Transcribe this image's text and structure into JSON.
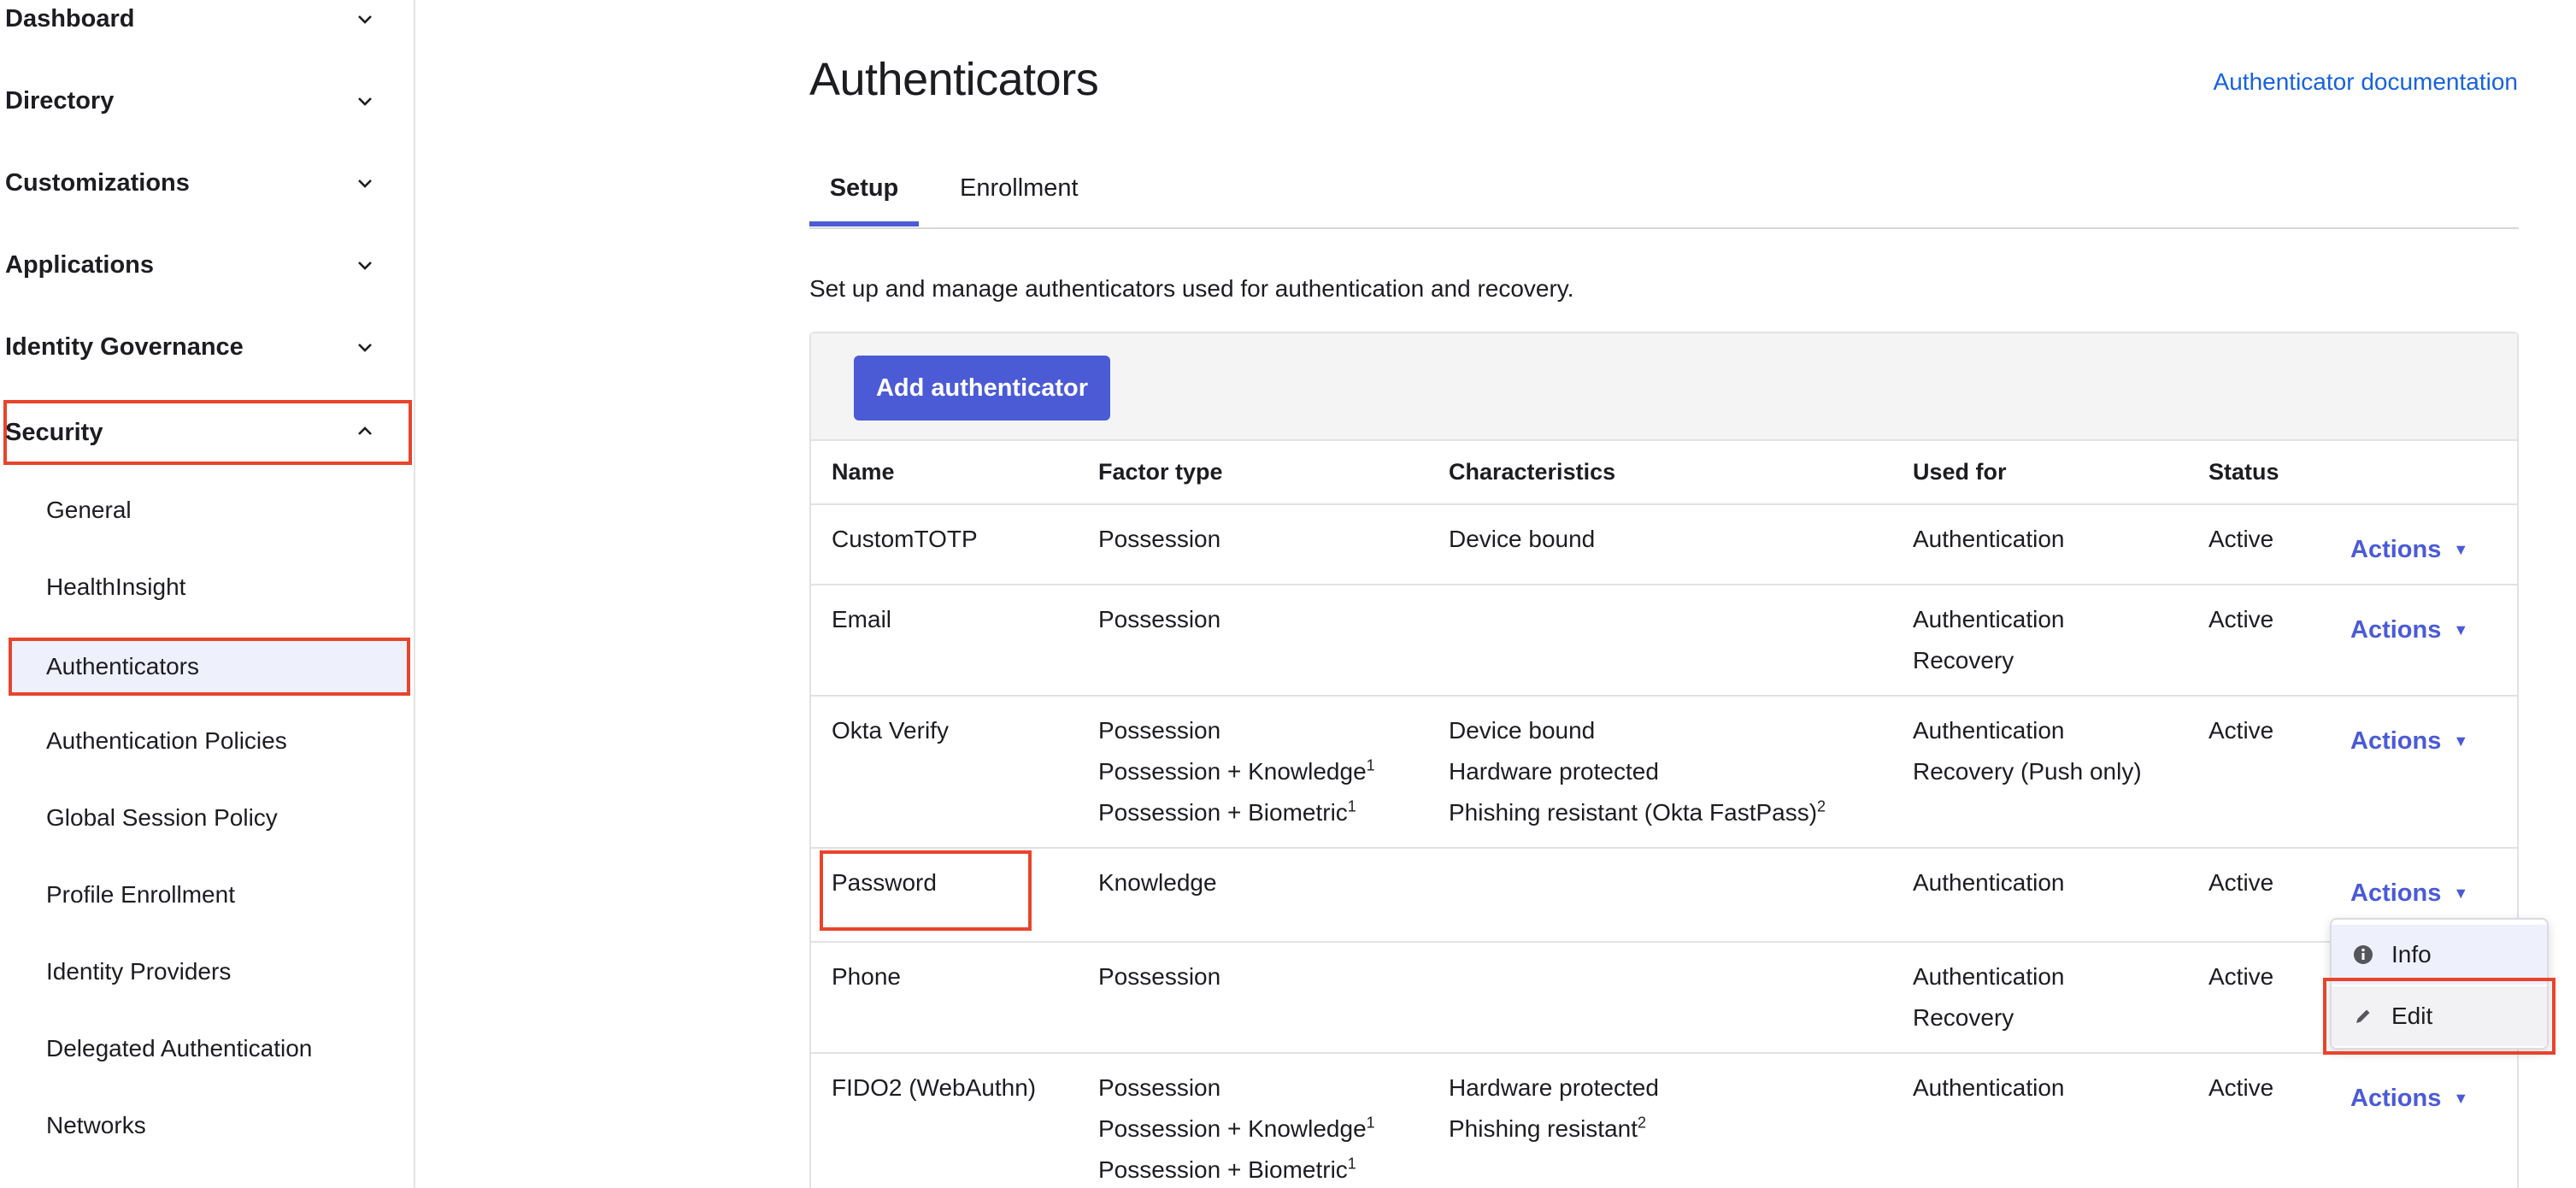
{
  "sidebar": {
    "groups": [
      {
        "label": "Dashboard",
        "icon": "chevron-down-icon"
      },
      {
        "label": "Directory",
        "icon": "chevron-down-icon"
      },
      {
        "label": "Customizations",
        "icon": "chevron-down-icon"
      },
      {
        "label": "Applications",
        "icon": "chevron-down-icon"
      },
      {
        "label": "Identity Governance",
        "icon": "chevron-down-icon"
      },
      {
        "label": "Security",
        "icon": "chevron-up-icon"
      }
    ],
    "security_items": [
      {
        "label": "General"
      },
      {
        "label": "HealthInsight"
      },
      {
        "label": "Authenticators"
      },
      {
        "label": "Authentication Policies"
      },
      {
        "label": "Global Session Policy"
      },
      {
        "label": "Profile Enrollment"
      },
      {
        "label": "Identity Providers"
      },
      {
        "label": "Delegated Authentication"
      },
      {
        "label": "Networks"
      }
    ]
  },
  "header": {
    "title": "Authenticators",
    "doc_link": "Authenticator documentation"
  },
  "tabs": [
    {
      "label": "Setup"
    },
    {
      "label": "Enrollment"
    }
  ],
  "description": "Set up and manage authenticators used for authentication and recovery.",
  "toolbar": {
    "add_label": "Add authenticator"
  },
  "table": {
    "headers": {
      "name": "Name",
      "factor": "Factor type",
      "characteristics": "Characteristics",
      "used_for": "Used for",
      "status": "Status"
    },
    "rows": [
      {
        "name": "CustomTOTP",
        "factor": [
          "Possession"
        ],
        "characteristics": [
          "Device bound"
        ],
        "used_for": [
          "Authentication"
        ],
        "status": "Active",
        "actions": "Actions"
      },
      {
        "name": "Email",
        "factor": [
          "Possession"
        ],
        "characteristics": [],
        "used_for": [
          "Authentication",
          "Recovery"
        ],
        "status": "Active",
        "actions": "Actions"
      },
      {
        "name": "Okta Verify",
        "factor": [
          "Possession",
          "Possession + Knowledge",
          "Possession + Biometric"
        ],
        "characteristics": [
          "Device bound",
          "Hardware protected",
          "Phishing resistant (Okta FastPass)"
        ],
        "used_for": [
          "Authentication",
          "Recovery (Push only)"
        ],
        "status": "Active",
        "actions": "Actions"
      },
      {
        "name": "Password",
        "factor": [
          "Knowledge"
        ],
        "characteristics": [],
        "used_for": [
          "Authentication"
        ],
        "status": "Active",
        "actions": "Actions"
      },
      {
        "name": "Phone",
        "factor": [
          "Possession"
        ],
        "characteristics": [],
        "used_for": [
          "Authentication",
          "Recovery"
        ],
        "status": "Active",
        "actions": "Actions"
      },
      {
        "name": "FIDO2 (WebAuthn)",
        "factor": [
          "Possession",
          "Possession + Knowledge",
          "Possession + Biometric"
        ],
        "characteristics": [
          "Hardware protected",
          "Phishing resistant"
        ],
        "used_for": [
          "Authentication"
        ],
        "status": "Active",
        "actions": "Actions"
      }
    ],
    "footnote_1": "1",
    "footnote_2": "2"
  },
  "dropdown": {
    "info_label": "Info",
    "info_icon": "info-icon",
    "edit_label": "Edit",
    "edit_icon": "pencil-icon"
  },
  "colors": {
    "accent": "#4b5bd6",
    "link": "#1662dd",
    "highlight": "#e8442c"
  }
}
